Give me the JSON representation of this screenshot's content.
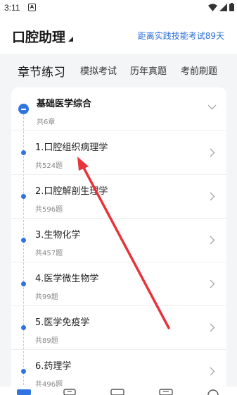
{
  "status": {
    "time": "3:11",
    "notification_badge": "A"
  },
  "header": {
    "title": "口腔助理",
    "countdown": "距离实践技能考试89天"
  },
  "tabs": [
    {
      "label": "章节练习",
      "active": true
    },
    {
      "label": "模拟考试",
      "active": false
    },
    {
      "label": "历年真题",
      "active": false
    },
    {
      "label": "考前刷题",
      "active": false
    }
  ],
  "group": {
    "title": "基础医学综合",
    "count": "共6章"
  },
  "chapters": [
    {
      "name": "1.口腔组织病理学",
      "count": "共524题"
    },
    {
      "name": "2.口腔解剖生理学",
      "count": "共596题"
    },
    {
      "name": "3.生物化学",
      "count": "共457题"
    },
    {
      "name": "4.医学微生物学",
      "count": "共99题"
    },
    {
      "name": "5.医学免疫学",
      "count": "共89题"
    },
    {
      "name": "6.药理学",
      "count": "共496题"
    }
  ],
  "colors": {
    "accent": "#2f74df",
    "annotation_arrow": "#e8333b"
  }
}
